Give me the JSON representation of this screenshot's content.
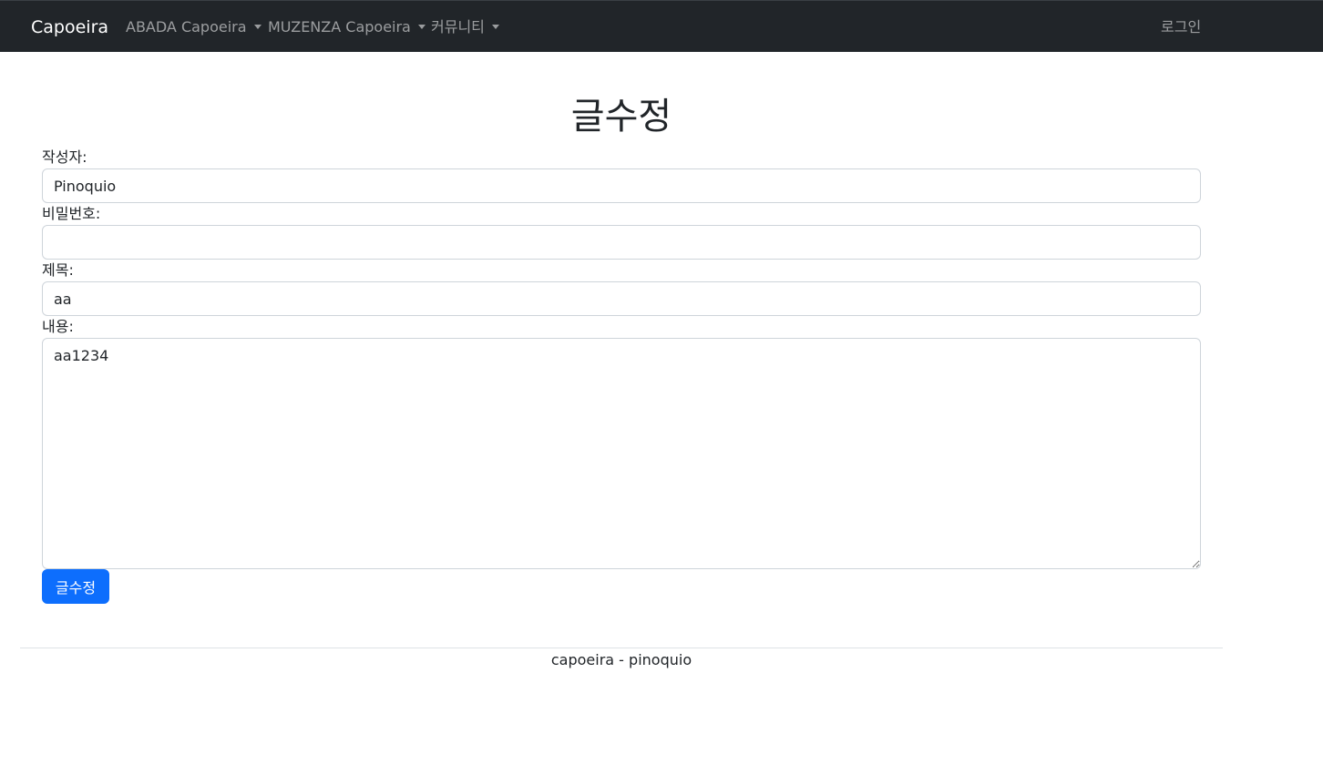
{
  "navbar": {
    "brand": "Capoeira",
    "menus": [
      {
        "label": "ABADA Capoeira"
      },
      {
        "label": "MUZENZA Capoeira"
      },
      {
        "label": "커뮤니티"
      }
    ],
    "login": "로그인"
  },
  "page": {
    "title": "글수정"
  },
  "form": {
    "author_label": "작성자:",
    "author_value": "Pinoquio",
    "password_label": "비밀번호:",
    "password_value": "",
    "subject_label": "제목:",
    "subject_value": "aa",
    "content_label": "내용:",
    "content_value": "aa1234",
    "submit_label": "글수정"
  },
  "footer": {
    "text": "capoeira - pinoquio"
  },
  "colors": {
    "navbar_bg": "#212529",
    "primary": "#0d6efd"
  }
}
